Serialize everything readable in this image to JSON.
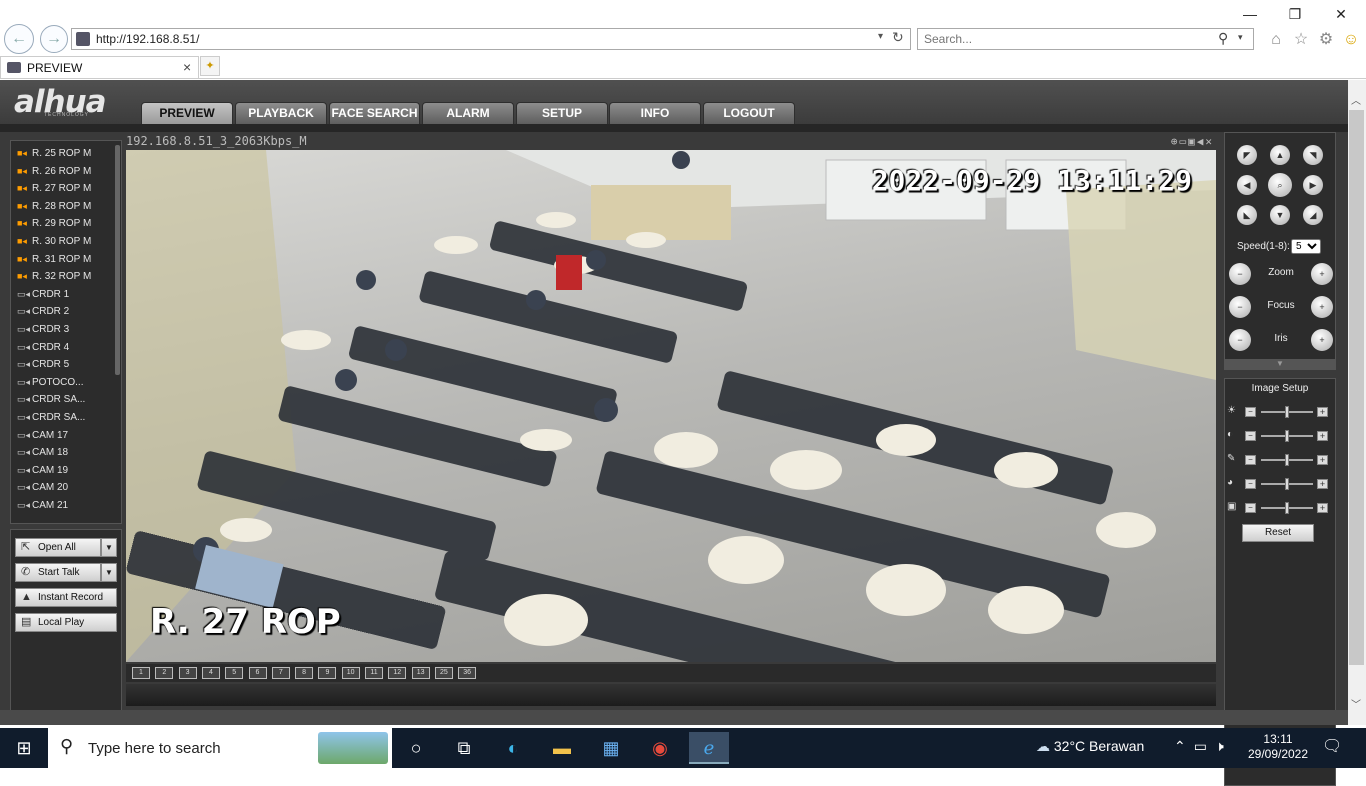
{
  "browser": {
    "address": "http://192.168.8.51/",
    "search_placeholder": "Search...",
    "tab_title": "PREVIEW",
    "tab_close": "×",
    "back_icon": "←",
    "forward_icon": "→",
    "minimize": "—",
    "restore": "❐",
    "close": "✕",
    "toolbar_icons": [
      "home-icon",
      "star-icon",
      "gear-icon",
      "smiley-icon"
    ]
  },
  "app": {
    "logo": "alhua",
    "logo_sub": "TECHNOLOGY",
    "nav": [
      "PREVIEW",
      "PLAYBACK",
      "FACE SEARCH",
      "ALARM",
      "SETUP",
      "INFO",
      "LOGOUT"
    ],
    "active_nav": "PREVIEW",
    "devices": [
      {
        "label": "R. 25 ROP   M",
        "state": "on"
      },
      {
        "label": "R. 26 ROP   M",
        "state": "on"
      },
      {
        "label": "R. 27 ROP   M",
        "state": "on"
      },
      {
        "label": "R. 28 ROP   M",
        "state": "on"
      },
      {
        "label": "R. 29 ROP   M",
        "state": "on"
      },
      {
        "label": "R. 30 ROP   M",
        "state": "on"
      },
      {
        "label": "R. 31 ROP   M",
        "state": "on"
      },
      {
        "label": "R. 32 ROP   M",
        "state": "on"
      },
      {
        "label": "CRDR 1",
        "state": "off"
      },
      {
        "label": "CRDR 2",
        "state": "off"
      },
      {
        "label": "CRDR 3",
        "state": "off"
      },
      {
        "label": "CRDR 4",
        "state": "off"
      },
      {
        "label": "CRDR 5",
        "state": "off"
      },
      {
        "label": "POTOCO...",
        "state": "off"
      },
      {
        "label": "CRDR SA...",
        "state": "off"
      },
      {
        "label": "CRDR SA...",
        "state": "off"
      },
      {
        "label": "CAM 17",
        "state": "off"
      },
      {
        "label": "CAM 18",
        "state": "off"
      },
      {
        "label": "CAM 19",
        "state": "off"
      },
      {
        "label": "CAM 20",
        "state": "off"
      },
      {
        "label": "CAM 21",
        "state": "off"
      }
    ],
    "buttons": {
      "open_all": "Open All",
      "start_talk": "Start Talk",
      "instant_record": "Instant Record",
      "local_play": "Local Play"
    },
    "video": {
      "header": "192.168.8.51_3_2063Kbps_M",
      "timestamp": "2022-09-29 13:11:29",
      "channel_name": "R. 27 ROP",
      "header_icons": "⊕▭▣◀✕"
    },
    "split_modes": [
      "1",
      "2",
      "3",
      "4",
      "5",
      "6",
      "7",
      "8",
      "9",
      "10",
      "11",
      "12",
      "13",
      "25",
      "36"
    ],
    "ptz": {
      "speed_label": "Speed(1-8):",
      "speed_value": "5",
      "zoom": "Zoom",
      "focus": "Focus",
      "iris": "Iris"
    },
    "image_setup": {
      "title": "Image Setup",
      "sliders": [
        {
          "icon": "brightness-icon",
          "level": 0.5
        },
        {
          "icon": "contrast-icon",
          "level": 0.5
        },
        {
          "icon": "saturation-icon",
          "level": 0.5
        },
        {
          "icon": "hue-icon",
          "level": 0.5
        },
        {
          "icon": "gain-icon",
          "level": 0.5
        }
      ],
      "reset": "Reset"
    }
  },
  "taskbar": {
    "search_placeholder": "Type here to search",
    "apps": [
      "task-view-icon",
      "edge-icon",
      "file-explorer-icon",
      "store-icon",
      "chrome-icon",
      "ie-icon"
    ],
    "weather": "32°C  Berawan",
    "time": "13:11",
    "date": "29/09/2022"
  },
  "colors": {
    "app_bg": "#3a3a3a",
    "accent_camera_on": "#ff9d00",
    "taskbar": "#101c2c"
  }
}
